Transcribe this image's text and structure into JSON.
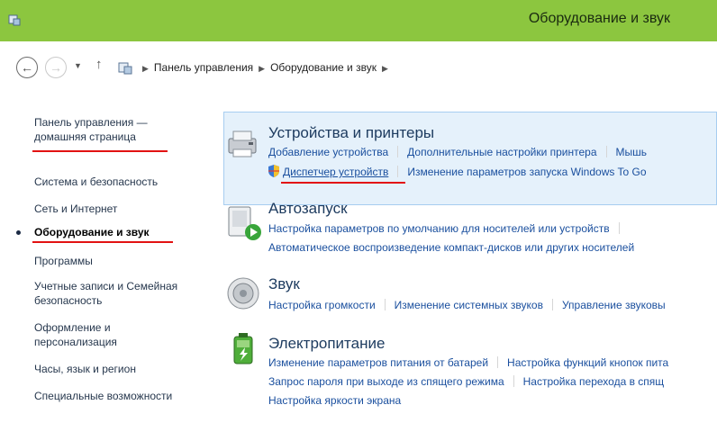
{
  "window": {
    "title": "Оборудование и звук"
  },
  "address": {
    "breadcrumbs": [
      "Панель управления",
      "Оборудование и звук"
    ]
  },
  "sidebar": {
    "items": [
      {
        "label_line1": "Панель управления —",
        "label_line2": "домашняя страница"
      },
      {
        "label": "Система и безопасность"
      },
      {
        "label": "Сеть и Интернет"
      },
      {
        "label": "Оборудование и звук",
        "active": true
      },
      {
        "label": "Программы"
      },
      {
        "label_line1": "Учетные записи и Семейная",
        "label_line2": "безопасность"
      },
      {
        "label_line1": "Оформление и",
        "label_line2": "персонализация"
      },
      {
        "label": "Часы, язык и регион"
      },
      {
        "label": "Специальные возможности"
      }
    ]
  },
  "categories": [
    {
      "title": "Устройства и принтеры",
      "icon": "printer-icon",
      "links": [
        [
          "Добавление устройства",
          "Дополнительные настройки принтера",
          "Мышь"
        ],
        [
          "Диспетчер устройств",
          "Изменение параметров запуска Windows To Go"
        ]
      ]
    },
    {
      "title": "Автозапуск",
      "icon": "autoplay-icon",
      "links": [
        [
          "Настройка параметров по умолчанию для носителей или устройств"
        ],
        [
          "Автоматическое воспроизведение компакт-дисков или других носителей"
        ]
      ]
    },
    {
      "title": "Звук",
      "icon": "speaker-icon",
      "links": [
        [
          "Настройка громкости",
          "Изменение системных звуков",
          "Управление звуковы"
        ]
      ]
    },
    {
      "title": "Электропитание",
      "icon": "battery-icon",
      "links": [
        [
          "Изменение параметров питания от батарей",
          "Настройка функций кнопок пита"
        ],
        [
          "Запрос пароля при выходе из спящего режима",
          "Настройка перехода в спящ"
        ],
        [
          "Настройка яркости экрана"
        ]
      ]
    }
  ],
  "colors": {
    "titlebar": "#8cc63f",
    "link": "#1a4f9e",
    "highlight": "#e5f1fb",
    "annotation": "#e21212"
  }
}
